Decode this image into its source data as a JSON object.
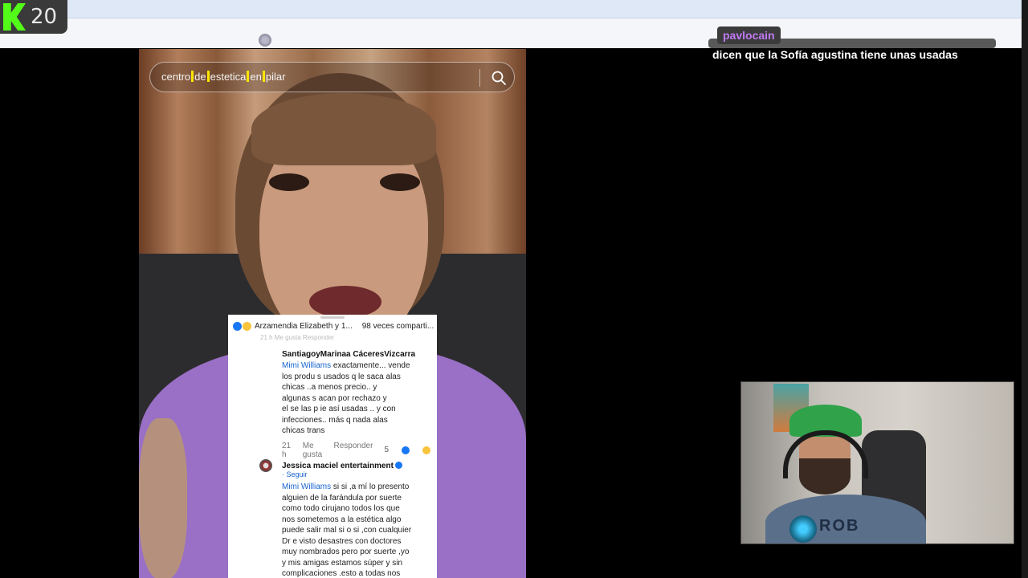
{
  "platform": {
    "badge_count": "20",
    "brand_color": "#53fc18"
  },
  "video": {
    "search_words": [
      "centro",
      "de",
      "estetica",
      "en",
      "pilar"
    ]
  },
  "comments_card": {
    "header": "Arzamendia Elizabeth y 1...",
    "shares": "98 veces comparti...",
    "faded_meta": "21 h     Me gusta     Responder",
    "comments": [
      {
        "author": "SantiagoyMarinaa CáceresVizcarra",
        "mention": "Mimi Williams",
        "text_lines": [
          " exactamente... vende",
          "los produ  s usados q le saca alas",
          "chicas ..a         menos precio.. y",
          "algunas s      acan por rechazo y",
          "el se las p   ie así usadas .. y con",
          "infecciones.. más q nada alas",
          "chicas trans"
        ],
        "time": "21 h",
        "like": "Me gusta",
        "reply": "Responder",
        "reaction_count": "5"
      },
      {
        "author": "Jessica maciel  entertainment",
        "follow": "· Seguir",
        "mention": "Mimi Williams",
        "text_lines": [
          " si si ,a mí lo presento",
          "alguien de la farándula por suerte",
          "como todo cirujano todos los que",
          "nos sometemos a la estética algo",
          "puede salir mal si o si ,con cualquier",
          "Dr e visto desastres con doctores",
          "muy nombrados pero por suerte ,yo",
          "y mis amigas estamos súper y sin",
          "complicaciones .esto a todas nos"
        ]
      }
    ]
  },
  "chat": {
    "username": "pavlocain",
    "username_color": "#c17af5",
    "message": "dicen que la Sofía agustina tiene unas usadas"
  },
  "webcam": {
    "shirt_text": "ROB"
  }
}
